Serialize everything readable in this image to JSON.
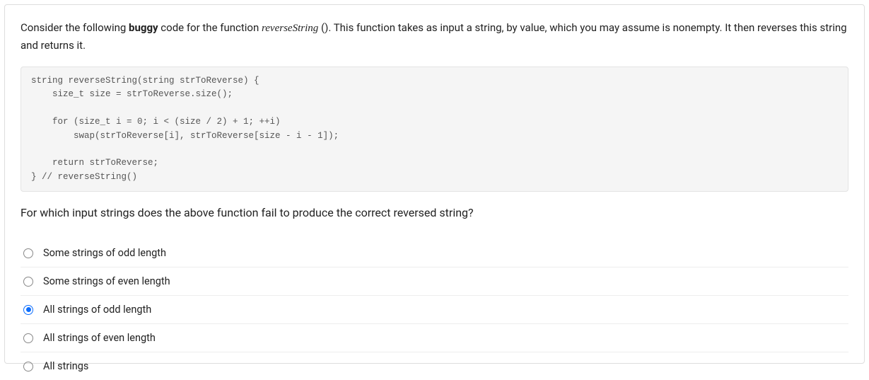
{
  "question": {
    "stem_pre": "Consider the following ",
    "stem_bold": "buggy",
    "stem_mid1": " code for the function ",
    "stem_fn": "reverseString",
    "stem_paren": " ()",
    "stem_mid2": ". This function takes as input a string, by value, which you may assume is nonempty. It then reverses this string and returns it.",
    "code": "string reverseString(string strToReverse) {\n    size_t size = strToReverse.size();\n\n    for (size_t i = 0; i < (size / 2) + 1; ++i)\n        swap(strToReverse[i], strToReverse[size - i - 1]);\n\n    return strToReverse;\n} // reverseString()",
    "prompt": "For which input strings does the above function fail to produce the correct reversed string?"
  },
  "options": [
    {
      "label": "Some strings of odd length",
      "selected": false
    },
    {
      "label": "Some strings of even length",
      "selected": false
    },
    {
      "label": "All strings of odd length",
      "selected": true
    },
    {
      "label": "All strings of even length",
      "selected": false
    },
    {
      "label": "All strings",
      "selected": false
    }
  ]
}
